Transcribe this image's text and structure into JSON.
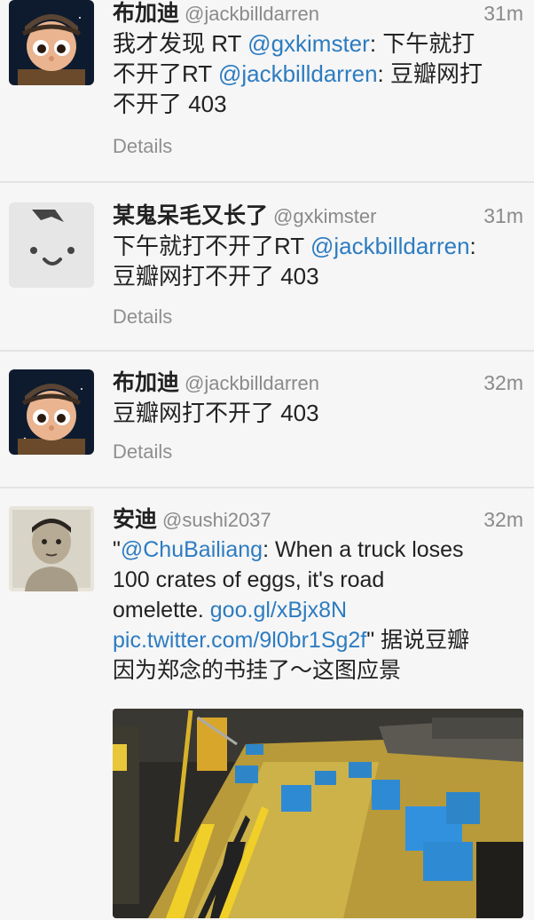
{
  "tweets": [
    {
      "display_name": "布加迪",
      "screen_name": "@jackbilldarren",
      "time": "31m",
      "line1_pre": "我才发现  RT ",
      "line1_link": "@gxkimster",
      "line1_post": ": 下午就打",
      "line2_pre": "不开了RT ",
      "line2_link": "@jackbilldarren",
      "line2_post": ": 豆瓣网打",
      "line3": "不开了  403",
      "details": "Details"
    },
    {
      "display_name": "某鬼呆毛又长了",
      "screen_name": "@gxkimster",
      "time": "31m",
      "line1_pre": "下午就打不开了RT ",
      "line1_link": "@jackbilldarren",
      "line1_post": ":",
      "line2": "豆瓣网打不开了  403",
      "details": "Details"
    },
    {
      "display_name": "布加迪",
      "screen_name": "@jackbilldarren",
      "time": "32m",
      "line1": "豆瓣网打不开了  403",
      "details": "Details"
    },
    {
      "display_name": "安迪",
      "screen_name": "@sushi2037",
      "time": "32m",
      "line1_pre": "\"",
      "line1_link": "@ChuBailiang",
      "line1_post": ": When a truck loses",
      "line2": "100 crates of eggs, it's road",
      "line3_pre": "omelette. ",
      "line3_link": "goo.gl/xBjx8N",
      "line4_link": "pic.twitter.com/9l0br1Sg2f",
      "line4_post": "\" 据说豆瓣",
      "line5": "因为郑念的书挂了～这图应景"
    }
  ],
  "colors": {
    "link": "#2d7cc1",
    "meta": "#8a8a8a",
    "divider": "#e3e3e3",
    "background": "#f6f6f6"
  }
}
